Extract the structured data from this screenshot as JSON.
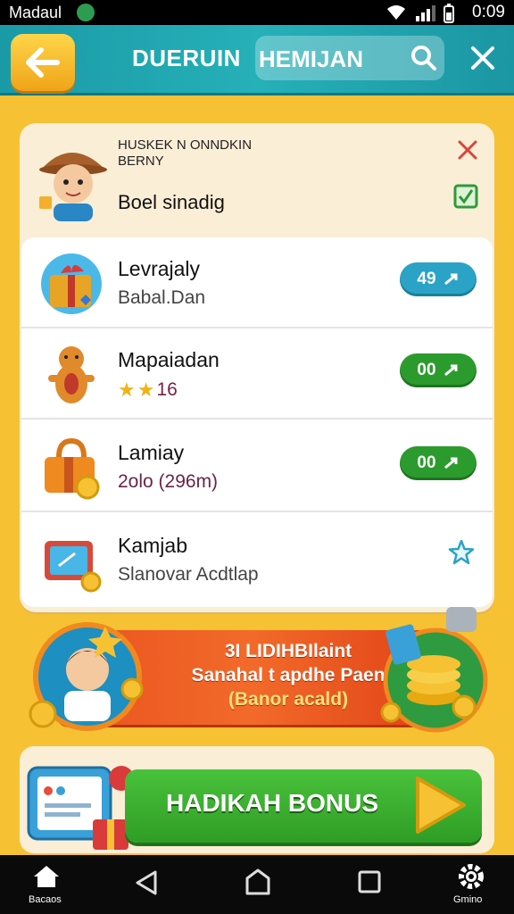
{
  "status_bar": {
    "carrier": "Madaul",
    "time": "0:09"
  },
  "header": {
    "title": "DUERUIN",
    "search_text": "HEMIJAN"
  },
  "top_card": {
    "small_line1": "HUSKEK N ONNDKIN",
    "small_line2": "BERNY",
    "main_text": "Boel sinadig"
  },
  "items": [
    {
      "title": "Levrajaly",
      "subtitle": "Babal.Dan",
      "badge": "49"
    },
    {
      "title": "Mapaiadan",
      "subtitle": "16",
      "badge": "00"
    },
    {
      "title": "Lamiay",
      "subtitle": "2olo (296m)",
      "badge": "00"
    },
    {
      "title": "Kamjab",
      "subtitle": "Slanovar Acdtlap",
      "badge": ""
    }
  ],
  "banner": {
    "line1": "3I LIDIHBIlaint",
    "line2": "Sanahal t apdhe Paen",
    "line3": "(Banor acald)"
  },
  "bonus": {
    "label": "HADIKAH BONUS"
  },
  "nav": {
    "home_label": "Bacaos",
    "settings_label": "Gmino"
  },
  "colors": {
    "header": "#1a9aa6",
    "accent": "#f6c233",
    "green": "#2c9b2e",
    "blue": "#2aa3c6",
    "banner": "#e9521e"
  }
}
